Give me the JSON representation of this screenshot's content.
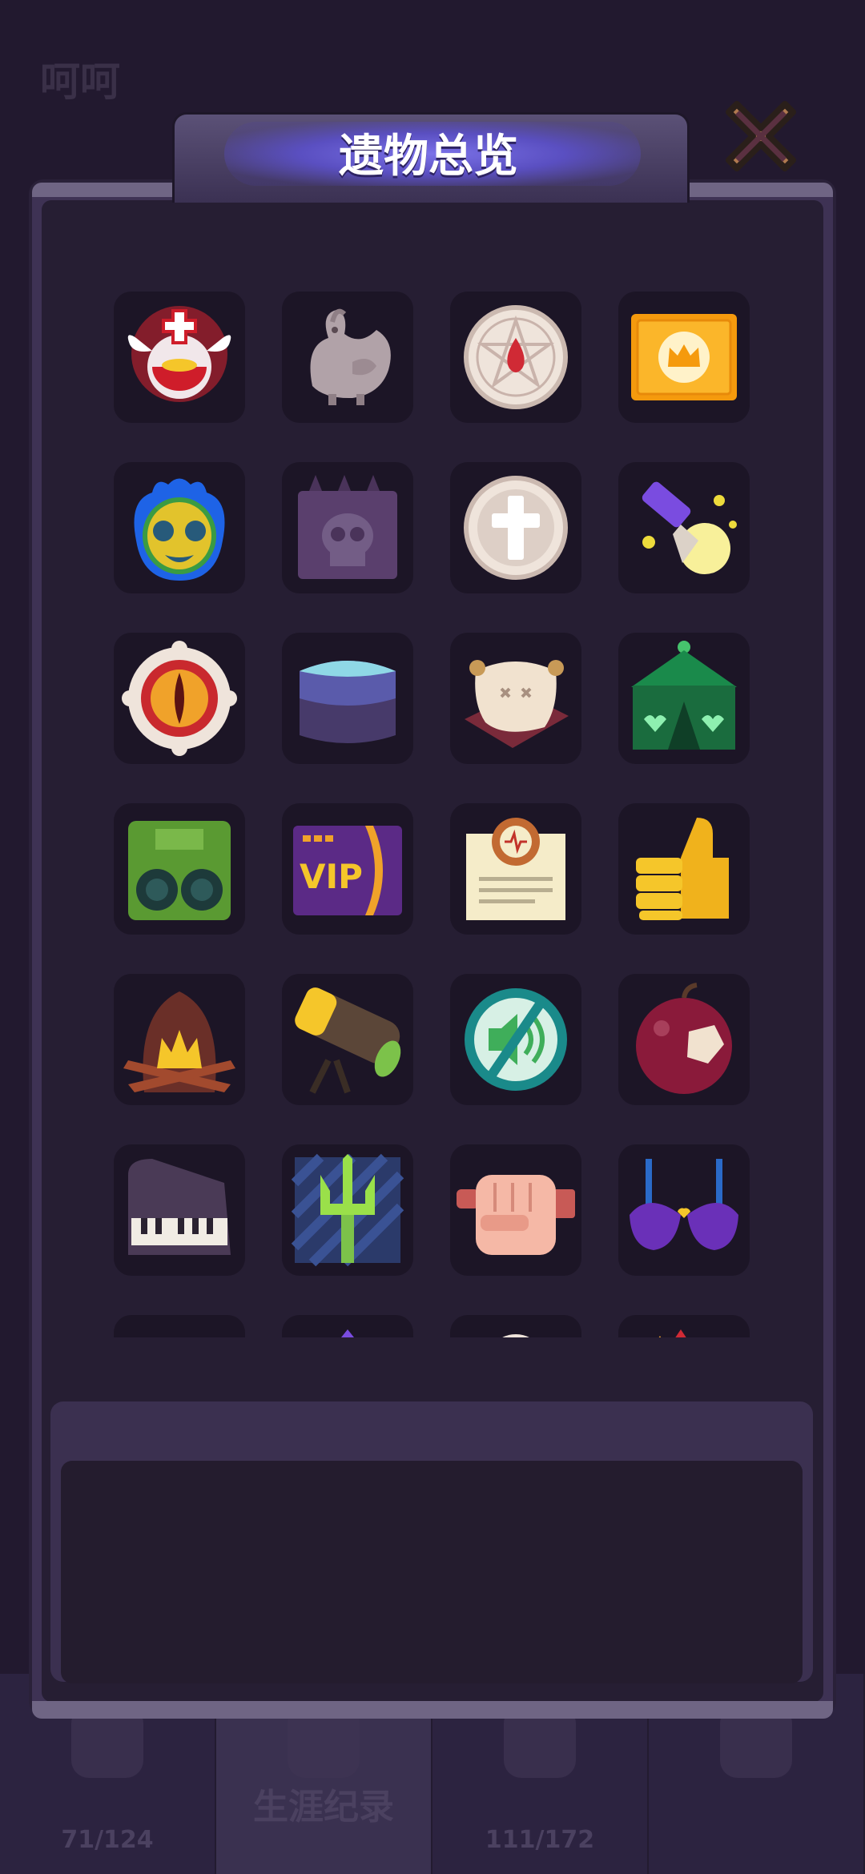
{
  "background": {
    "corner_text": "呵呵",
    "tabs": [
      {
        "label": "",
        "count": "71/124"
      },
      {
        "label": "生涯纪录",
        "count": ""
      },
      {
        "label": "",
        "count": "111/172"
      },
      {
        "label": "",
        "count": ""
      }
    ]
  },
  "dialog": {
    "title": "遗物总览",
    "close_icon": "close-x-icon"
  },
  "relics": [
    {
      "icon": "angel-potion-icon"
    },
    {
      "icon": "stone-rooster-icon"
    },
    {
      "icon": "pentagram-coin-icon"
    },
    {
      "icon": "gold-crown-card-icon"
    },
    {
      "icon": "flaming-mask-icon"
    },
    {
      "icon": "skull-block-icon"
    },
    {
      "icon": "cross-coin-icon"
    },
    {
      "icon": "magic-wand-icon"
    },
    {
      "icon": "eye-ring-icon"
    },
    {
      "icon": "ice-cube-icon"
    },
    {
      "icon": "pillow-icon"
    },
    {
      "icon": "green-tent-icon"
    },
    {
      "icon": "green-speaker-icon"
    },
    {
      "icon": "vip-card-icon"
    },
    {
      "icon": "certificate-icon"
    },
    {
      "icon": "thumbs-up-icon"
    },
    {
      "icon": "campfire-icon"
    },
    {
      "icon": "telescope-icon"
    },
    {
      "icon": "mute-icon"
    },
    {
      "icon": "bitten-apple-icon"
    },
    {
      "icon": "piano-icon"
    },
    {
      "icon": "trident-icon"
    },
    {
      "icon": "fist-icon"
    },
    {
      "icon": "bra-icon"
    }
  ]
}
